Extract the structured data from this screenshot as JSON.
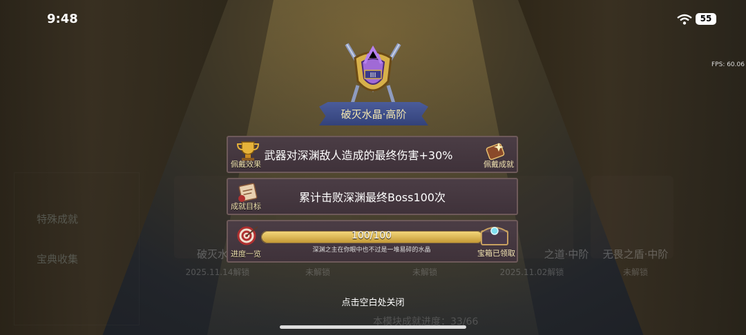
{
  "status": {
    "time": "9:48",
    "battery": "55",
    "fps": "FPS: 60.06"
  },
  "achievement": {
    "title": "破灭水晶·高阶",
    "effect_tag": "佩戴效果",
    "effect_text": "武器对深渊敌人造成的最终伤害+30%",
    "wear_tag": "佩戴成就",
    "goal_tag": "成就目标",
    "goal_text": "累计击败深渊最终Boss100次",
    "progress_tag": "进度一览",
    "progress_text": "100/100",
    "progress_value": 1.0,
    "progress_flavor": "深渊之主在你眼中也不过是一堆易碎的水晶",
    "chest_tag": "宝箱已领取"
  },
  "background": {
    "side_items": [
      "特殊成就",
      "宝典收集"
    ],
    "cards": [
      {
        "title": "破灭水晶",
        "sub": "2025.11.14解锁"
      },
      {
        "title": "",
        "sub": "未解锁"
      },
      {
        "title": "",
        "sub": "未解锁"
      },
      {
        "title": "之道·中阶",
        "sub": "2025.11.02解锁"
      },
      {
        "title": "无畏之盾·中阶",
        "sub": "未解锁"
      }
    ],
    "module_progress": "本模块成就进度：33/66"
  },
  "close_hint": "点击空白处关闭",
  "colors": {
    "accent_gold": "#f0e2b0",
    "panel_bg": "#45383f",
    "ribbon": "#3e4e8a"
  }
}
